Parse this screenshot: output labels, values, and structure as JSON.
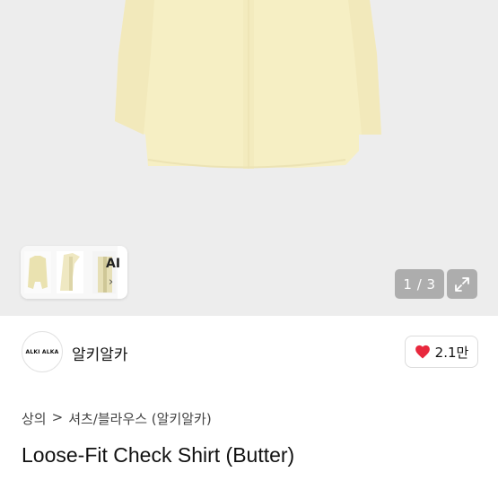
{
  "gallery": {
    "thumb_label": "AI",
    "pager": "1 / 3"
  },
  "shop": {
    "logo_text": "ALKI ALKA",
    "name": "알키알카",
    "likes": "2.1만"
  },
  "breadcrumb": {
    "level1": "상의",
    "separator": ">",
    "level2": "셔츠/블라우스 (알키알카)"
  },
  "product": {
    "title": "Loose-Fit Check Shirt (Butter)"
  },
  "colors": {
    "heart": "#e8283d",
    "shirt": "#f6efc4",
    "hero_bg": "#ededed"
  }
}
